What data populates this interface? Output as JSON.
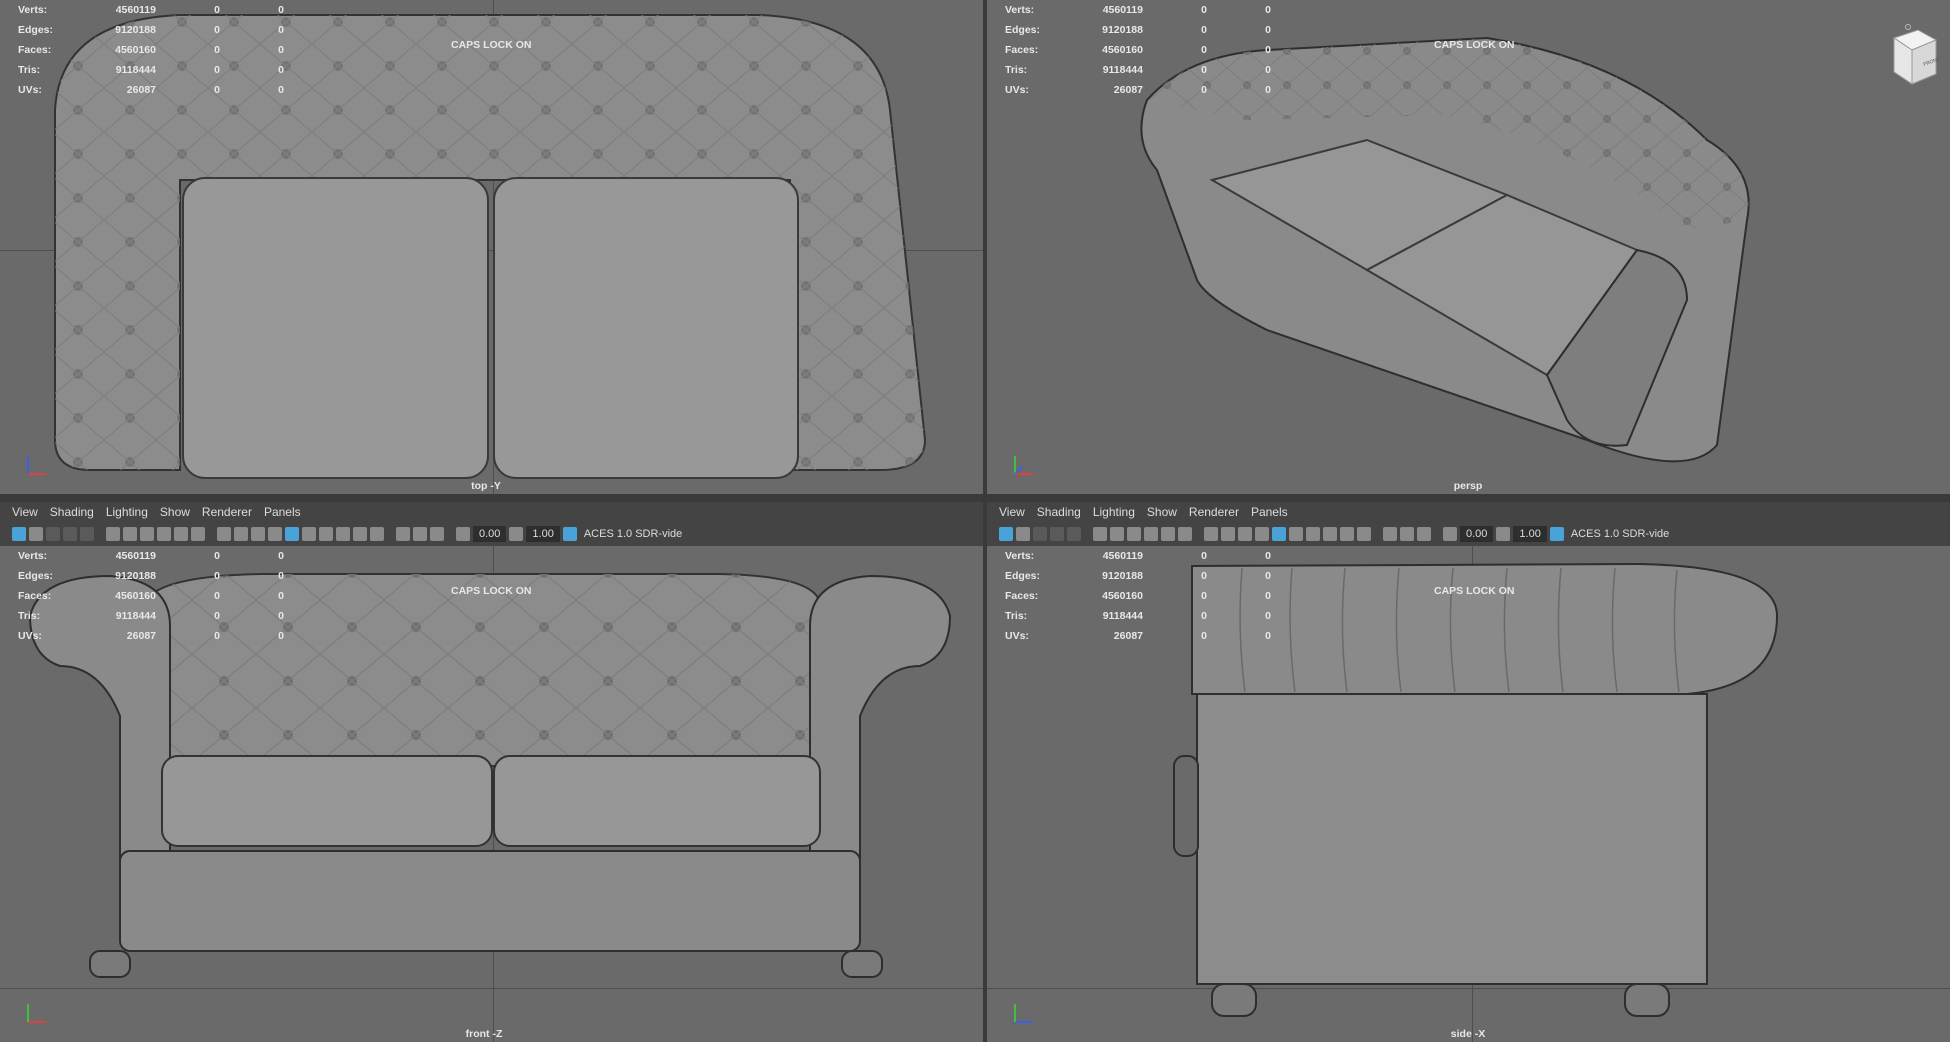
{
  "stats": {
    "rows": [
      {
        "label": "Verts:",
        "v1": "4560119",
        "v2": "0",
        "v3": "0"
      },
      {
        "label": "Edges:",
        "v1": "9120188",
        "v2": "0",
        "v3": "0"
      },
      {
        "label": "Faces:",
        "v1": "4560160",
        "v2": "0",
        "v3": "0"
      },
      {
        "label": "Tris:",
        "v1": "9118444",
        "v2": "0",
        "v3": "0"
      },
      {
        "label": "UVs:",
        "v1": "26087",
        "v2": "0",
        "v3": "0"
      }
    ]
  },
  "caps_text": "CAPS LOCK ON",
  "viewports": {
    "top": {
      "camera": "top -Y"
    },
    "persp": {
      "camera": "persp"
    },
    "front": {
      "camera": "front -Z"
    },
    "side": {
      "camera": "side -X"
    }
  },
  "panel_menu": [
    "View",
    "Shading",
    "Lighting",
    "Show",
    "Renderer",
    "Panels"
  ],
  "panel_toolbar": {
    "exposure": "0.00",
    "gamma": "1.00",
    "color_space": "ACES 1.0 SDR-vide"
  },
  "navcube": {
    "face_label": "FRONT"
  },
  "colors": {
    "viewport_bg": "#6a6a6a",
    "icon_accent": "#4aa3d8",
    "axis_x": "#e04040",
    "axis_y": "#40c040",
    "axis_z": "#4060e0"
  }
}
